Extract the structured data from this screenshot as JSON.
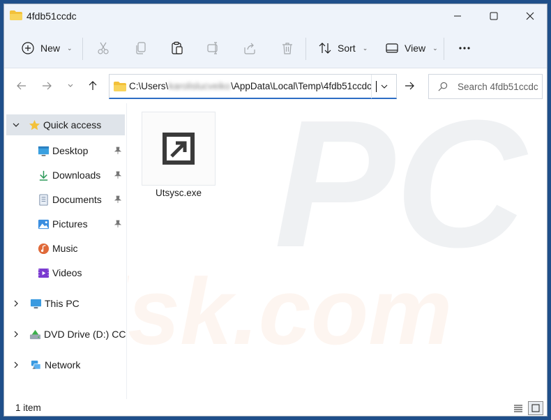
{
  "window": {
    "title": "4fdb51ccdc"
  },
  "toolbar": {
    "new_label": "New",
    "sort_label": "Sort",
    "view_label": "View"
  },
  "address": {
    "prefix": "C:\\Users\\",
    "blurred_user": "karolislucveiko",
    "suffix": "\\AppData\\Local\\Temp\\4fdb51ccdc"
  },
  "search": {
    "placeholder": "Search 4fdb51ccdc"
  },
  "sidebar": {
    "items": [
      {
        "label": "Quick access",
        "icon": "star-icon",
        "pinned": false
      },
      {
        "label": "Desktop",
        "icon": "desktop-icon",
        "pinned": true
      },
      {
        "label": "Downloads",
        "icon": "download-icon",
        "pinned": true
      },
      {
        "label": "Documents",
        "icon": "documents-icon",
        "pinned": true
      },
      {
        "label": "Pictures",
        "icon": "pictures-icon",
        "pinned": true
      },
      {
        "label": "Music",
        "icon": "music-icon",
        "pinned": false
      },
      {
        "label": "Videos",
        "icon": "videos-icon",
        "pinned": false
      },
      {
        "label": "This PC",
        "icon": "this-pc-icon",
        "pinned": false
      },
      {
        "label": "DVD Drive (D:) CCCC",
        "icon": "dvd-drive-icon",
        "pinned": false
      },
      {
        "label": "Network",
        "icon": "network-icon",
        "pinned": false
      }
    ]
  },
  "files": [
    {
      "name": "Utsysc.exe",
      "icon": "shortcut-arrow-icon"
    }
  ],
  "status": {
    "item_count": "1 item"
  },
  "watermark": {
    "text_top": "PC",
    "text_bottom": "risk.com"
  },
  "colors": {
    "accent": "#2d6dc4",
    "titlebar_bg": "#eef3fa",
    "selected_bg": "#dfe4ea",
    "folder_yellow": "#f3c13a",
    "watermark_orange": "#f07a3a"
  }
}
